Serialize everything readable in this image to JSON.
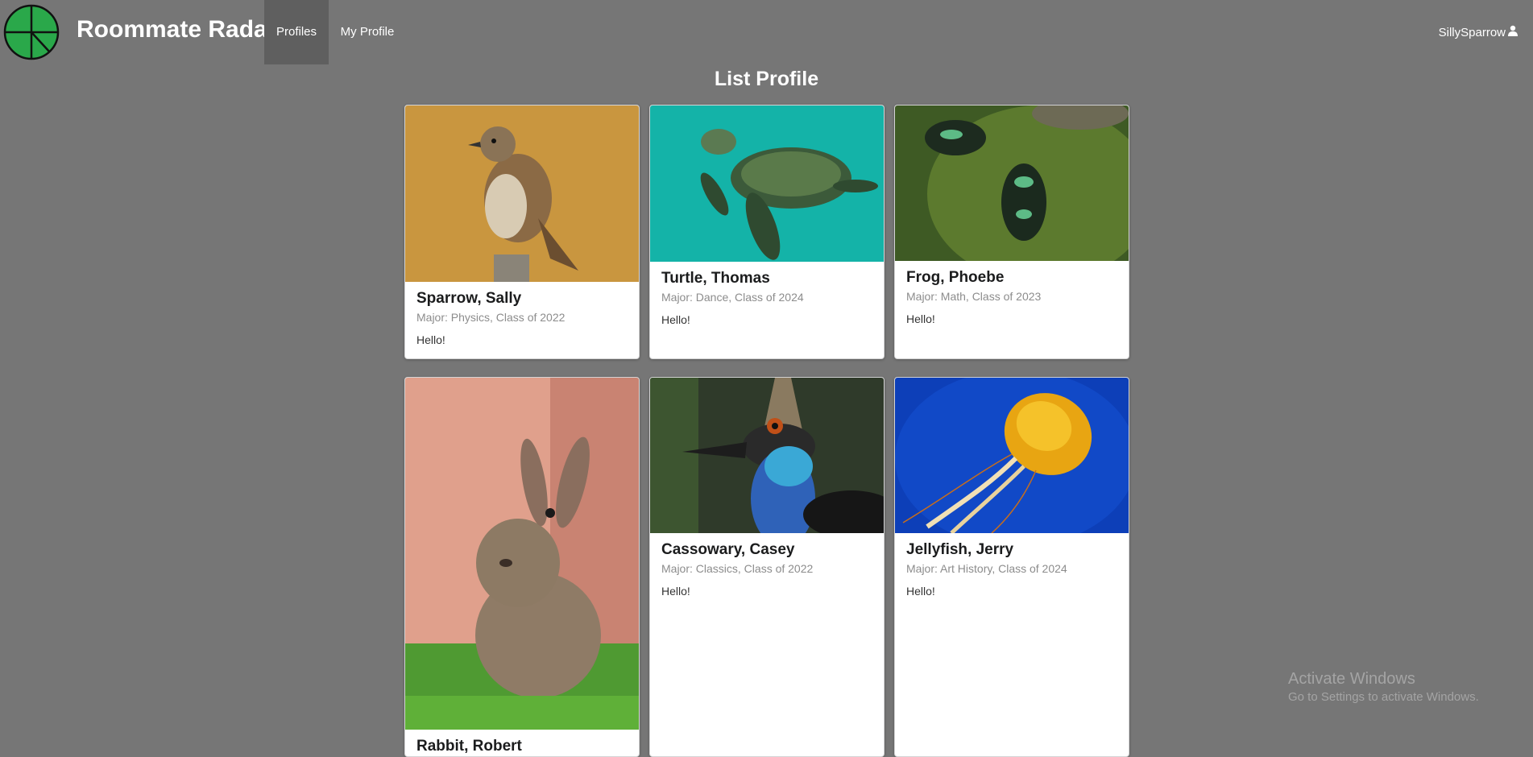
{
  "app": {
    "brand": "Roommate Radar",
    "nav": [
      {
        "label": "Profiles",
        "active": true
      },
      {
        "label": "My Profile",
        "active": false
      }
    ],
    "user": {
      "name": "SillySparrow",
      "icon": "user-icon"
    },
    "colors": {
      "background": "#767676",
      "active_nav": "#5f5f5f",
      "logo_green": "#2aa84a"
    }
  },
  "page": {
    "title": "List Profile"
  },
  "profiles": [
    {
      "name": "Sparrow, Sally",
      "meta": "Major: Physics, Class of 2022",
      "description": "Hello!",
      "image": "sparrow-photo"
    },
    {
      "name": "Turtle, Thomas",
      "meta": "Major: Dance, Class of 2024",
      "description": "Hello!",
      "image": "turtle-photo"
    },
    {
      "name": "Frog, Phoebe",
      "meta": "Major: Math, Class of 2023",
      "description": "Hello!",
      "image": "frog-photo"
    },
    {
      "name": "Rabbit, Robert",
      "meta": "",
      "description": "",
      "image": "rabbit-photo"
    },
    {
      "name": "Cassowary, Casey",
      "meta": "Major: Classics, Class of 2022",
      "description": "Hello!",
      "image": "cassowary-photo"
    },
    {
      "name": "Jellyfish, Jerry",
      "meta": "Major: Art History, Class of 2024",
      "description": "Hello!",
      "image": "jellyfish-photo"
    }
  ],
  "watermark": {
    "title": "Activate Windows",
    "subtitle": "Go to Settings to activate Windows."
  }
}
